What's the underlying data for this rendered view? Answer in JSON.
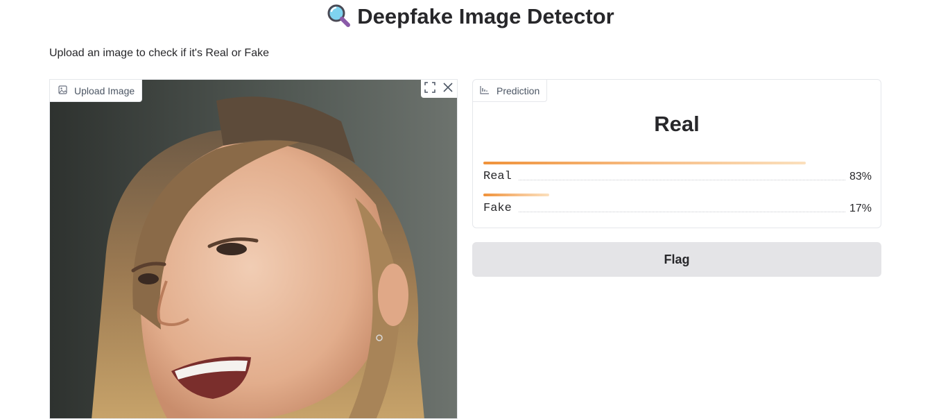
{
  "header": {
    "title": "Deepfake Image Detector",
    "title_icon": "magnifier-icon",
    "subtitle": "Upload an image to check if it's Real or Fake"
  },
  "input_panel": {
    "label": "Upload Image",
    "label_icon": "image-icon",
    "tools": [
      "fullscreen-icon",
      "close-icon"
    ],
    "image_content": "photo of smiling woman"
  },
  "output_panel": {
    "label": "Prediction",
    "label_icon": "bar-chart-icon",
    "prediction": "Real",
    "confidences": [
      {
        "label": "Real",
        "value": 0.83,
        "display": "83%"
      },
      {
        "label": "Fake",
        "value": 0.17,
        "display": "17%"
      }
    ]
  },
  "actions": {
    "flag_label": "Flag"
  },
  "colors": {
    "bar_start": "#f0923a",
    "bar_end": "#fbe0bd",
    "flag_bg": "#e4e4e7"
  }
}
